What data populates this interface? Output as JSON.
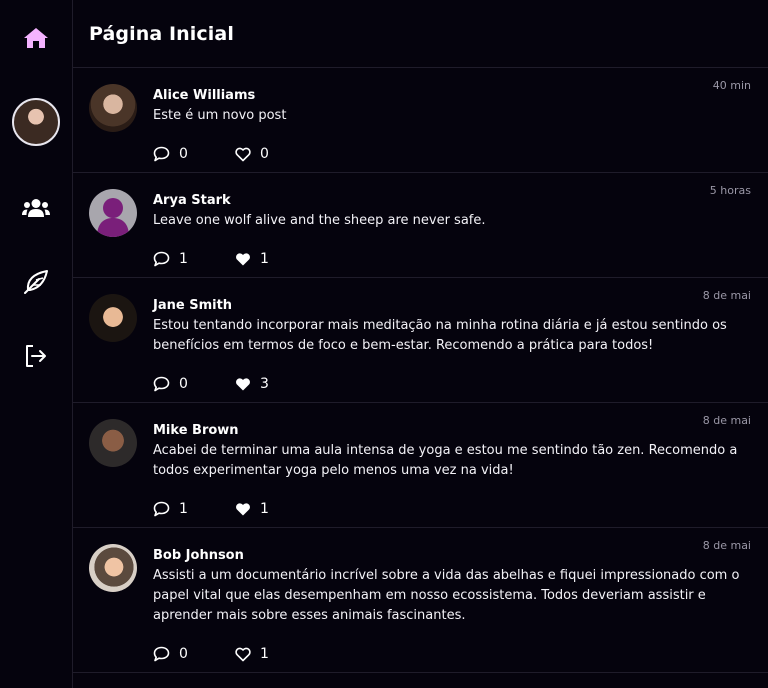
{
  "colors": {
    "background": "#05030d",
    "accent": "#f4b3ff",
    "border": "#1f1c2a",
    "muted_text": "#9a97a6"
  },
  "sidebar": {
    "items": [
      {
        "icon": "home-icon"
      },
      {
        "icon": "profile-avatar"
      },
      {
        "icon": "users-icon"
      },
      {
        "icon": "feather-icon"
      },
      {
        "icon": "logout-icon"
      }
    ]
  },
  "header": {
    "title": "Página Inicial"
  },
  "posts": [
    {
      "author": "Alice Williams",
      "time": "40 min",
      "text": "Este é um novo post",
      "comments": "0",
      "likes": "0",
      "liked": false
    },
    {
      "author": "Arya Stark",
      "time": "5 horas",
      "text": "Leave one wolf alive and the sheep are never safe.",
      "comments": "1",
      "likes": "1",
      "liked": true
    },
    {
      "author": "Jane Smith",
      "time": "8 de mai",
      "text": "Estou tentando incorporar mais meditação na minha rotina diária e já estou sentindo os benefícios em termos de foco e bem-estar. Recomendo a prática para todos!",
      "comments": "0",
      "likes": "3",
      "liked": true
    },
    {
      "author": "Mike Brown",
      "time": "8 de mai",
      "text": "Acabei de terminar uma aula intensa de yoga e estou me sentindo tão zen. Recomendo a todos experimentar yoga pelo menos uma vez na vida!",
      "comments": "1",
      "likes": "1",
      "liked": true
    },
    {
      "author": "Bob Johnson",
      "time": "8 de mai",
      "text": "Assisti a um documentário incrível sobre a vida das abelhas e fiquei impressionado com o papel vital que elas desempenham em nosso ecossistema. Todos deveriam assistir e aprender mais sobre esses animais fascinantes.",
      "comments": "0",
      "likes": "1",
      "liked": false
    }
  ]
}
